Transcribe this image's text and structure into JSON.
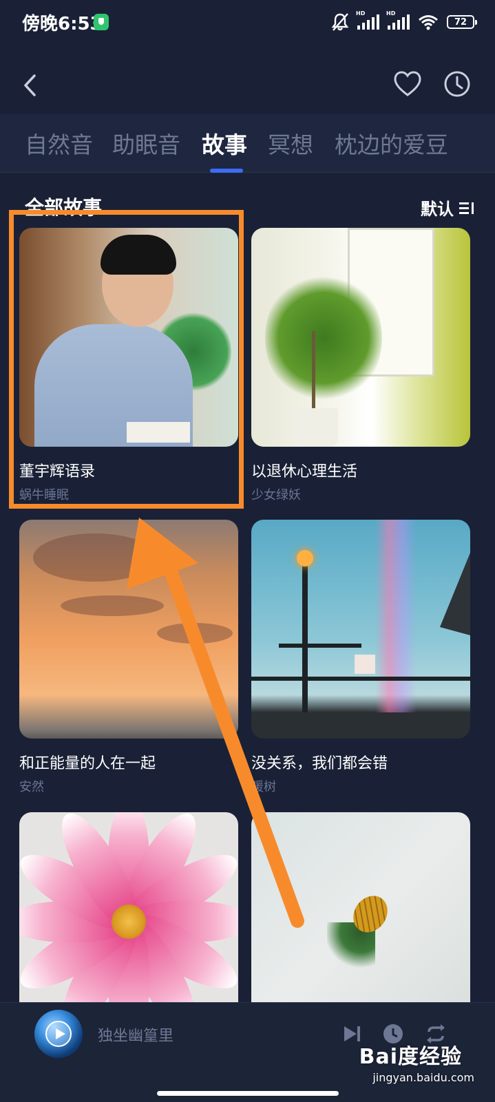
{
  "status_bar": {
    "time": "傍晚6:53",
    "battery": "72",
    "signal1_label": "HD",
    "signal2_label": "HD"
  },
  "header": {
    "back_icon": "chevron-left-icon",
    "favorite_icon": "heart-icon",
    "timer_icon": "clock-icon"
  },
  "tabs": [
    {
      "label": "自然音",
      "active": false
    },
    {
      "label": "助眠音",
      "active": false
    },
    {
      "label": "故事",
      "active": true
    },
    {
      "label": "冥想",
      "active": false
    },
    {
      "label": "枕边的爱豆",
      "active": false
    }
  ],
  "section": {
    "title": "全部故事",
    "sort_label": "默认"
  },
  "cards": [
    {
      "title": "董宇辉语录",
      "author": "蜗牛睡眠"
    },
    {
      "title": "以退休心理生活",
      "author": "少女绿妖"
    },
    {
      "title": "和正能量的人在一起",
      "author": "安然"
    },
    {
      "title": "没关系，我们都会错",
      "author": "暖树"
    },
    {
      "title": "",
      "author": ""
    },
    {
      "title": "",
      "author": ""
    }
  ],
  "player": {
    "track_title": "独坐幽篁里",
    "controls": [
      "skip-next-icon",
      "timer-icon",
      "repeat-icon"
    ]
  },
  "watermark": {
    "brand": "Bai度经验",
    "url": "jingyan.baidu.com"
  },
  "colors": {
    "background": "#1a2136",
    "tab_active": "#ffffff",
    "tab_inactive": "#6e7894",
    "tab_indicator": "#3d6cf2",
    "annotation": "#f78b2c"
  }
}
